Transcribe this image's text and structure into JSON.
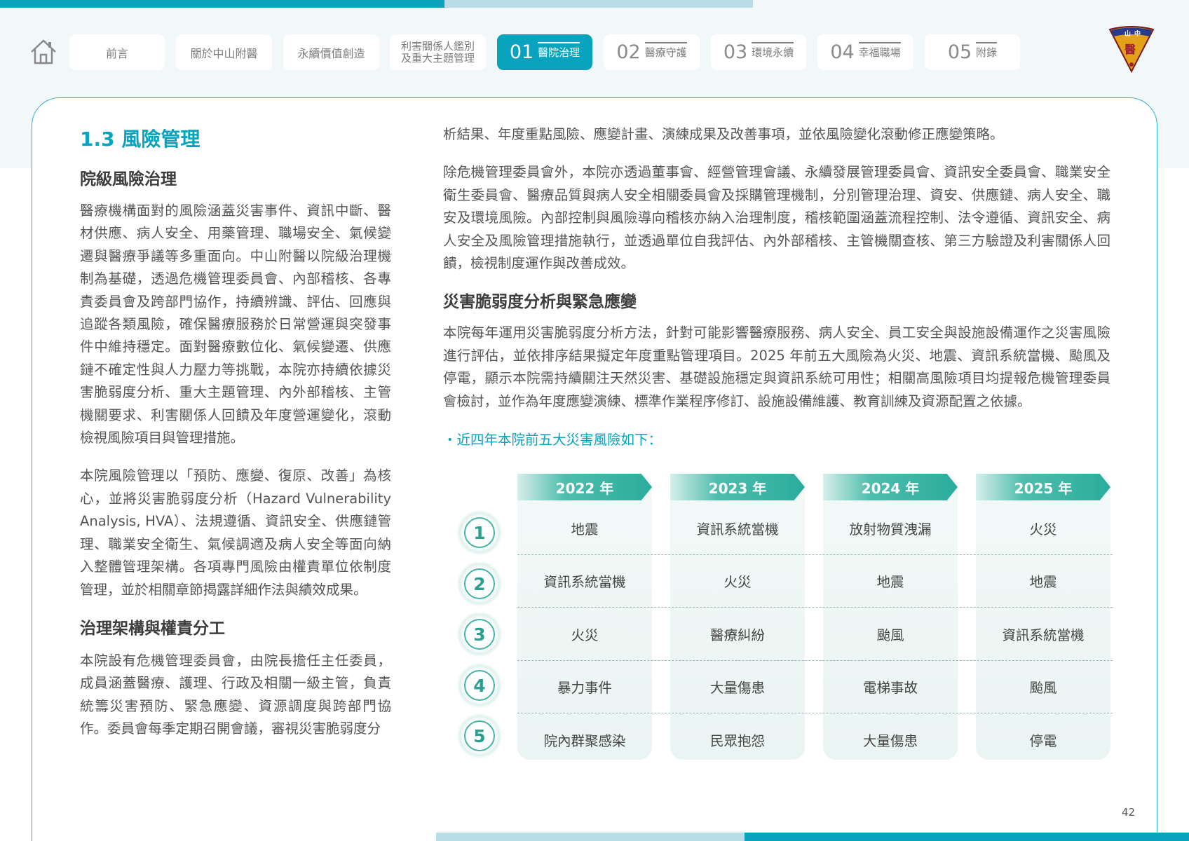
{
  "nav": {
    "tabs": [
      {
        "label": "前言"
      },
      {
        "label": "關於中山附醫"
      },
      {
        "label": "永續價值創造"
      },
      {
        "line1": "利害關係人鑑別",
        "line2": "及重大主題管理"
      },
      {
        "num": "01",
        "label": "醫院治理"
      },
      {
        "num": "02",
        "label": "醫療守護"
      },
      {
        "num": "03",
        "label": "環境永續"
      },
      {
        "num": "04",
        "label": "幸福職場"
      },
      {
        "num": "05",
        "label": "附錄"
      }
    ],
    "logo_text": "山中 醫"
  },
  "left": {
    "section_title": "1.3 風險管理",
    "h1": "院級風險治理",
    "p1": "醫療機構面對的風險涵蓋災害事件、資訊中斷、醫材供應、病人安全、用藥管理、職場安全、氣候變遷與醫療爭議等多重面向。中山附醫以院級治理機制為基礎，透過危機管理委員會、內部稽核、各專責委員會及跨部門協作，持續辨識、評估、回應與追蹤各類風險，確保醫療服務於日常營運與突發事件中維持穩定。面對醫療數位化、氣候變遷、供應鏈不確定性與人力壓力等挑戰，本院亦持續依據災害脆弱度分析、重大主題管理、內外部稽核、主管機關要求、利害關係人回饋及年度營運變化，滾動檢視風險項目與管理措施。",
    "p2": "本院風險管理以「預防、應變、復原、改善」為核心，並將災害脆弱度分析（Hazard Vulnerability Analysis, HVA）、法規遵循、資訊安全、供應鏈管理、職業安全衛生、氣候調適及病人安全等面向納入整體管理架構。各項專門風險由權責單位依制度管理，並於相關章節揭露詳細作法與績效成果。",
    "h2": "治理架構與權責分工",
    "p3": "本院設有危機管理委員會，由院長擔任主任委員，成員涵蓋醫療、護理、行政及相關一級主管，負責統籌災害預防、緊急應變、資源調度與跨部門協作。委員會每季定期召開會議，審視災害脆弱度分"
  },
  "right": {
    "p0": "析結果、年度重點風險、應變計畫、演練成果及改善事項，並依風險變化滾動修正應變策略。",
    "p1": "除危機管理委員會外，本院亦透過董事會、經營管理會議、永續發展管理委員會、資訊安全委員會、職業安全衛生委員會、醫療品質與病人安全相關委員會及採購管理機制，分別管理治理、資安、供應鏈、病人安全、職安及環境風險。內部控制與風險導向稽核亦納入治理制度，稽核範圍涵蓋流程控制、法令遵循、資訊安全、病人安全及風險管理措施執行，並透過單位自我評估、內外部稽核、主管機關查核、第三方驗證及利害關係人回饋，檢視制度運作與改善成效。",
    "h1": "災害脆弱度分析與緊急應變",
    "p2": "本院每年運用災害脆弱度分析方法，針對可能影響醫療服務、病人安全、員工安全與設施設備運作之災害風險進行評估，並依排序結果擬定年度重點管理項目。2025 年前五大風險為火災、地震、資訊系統當機、颱風及停電，顯示本院需持續關注天然災害、基礎設施穩定與資訊系統可用性；相關高風險項目均提報危機管理委員會檢討，並作為年度應變演練、標準作業程序修訂、設施設備維護、教育訓練及資源配置之依據。",
    "bullet": "・近四年本院前五大災害風險如下：",
    "table": {
      "ranks": [
        "1",
        "2",
        "3",
        "4",
        "5"
      ],
      "years": [
        {
          "year": "2022 年",
          "items": [
            "地震",
            "資訊系統當機",
            "火災",
            "暴力事件",
            "院內群聚感染"
          ]
        },
        {
          "year": "2023 年",
          "items": [
            "資訊系統當機",
            "火災",
            "醫療糾紛",
            "大量傷患",
            "民眾抱怨"
          ]
        },
        {
          "year": "2024 年",
          "items": [
            "放射物質洩漏",
            "地震",
            "颱風",
            "電梯事故",
            "大量傷患"
          ]
        },
        {
          "year": "2025 年",
          "items": [
            "火災",
            "地震",
            "資訊系統當機",
            "颱風",
            "停電"
          ]
        }
      ]
    }
  },
  "page_number": "42",
  "colors": {
    "accent": "#0aa3bd",
    "teal": "#2aac9c",
    "light": "#b9dde6"
  }
}
